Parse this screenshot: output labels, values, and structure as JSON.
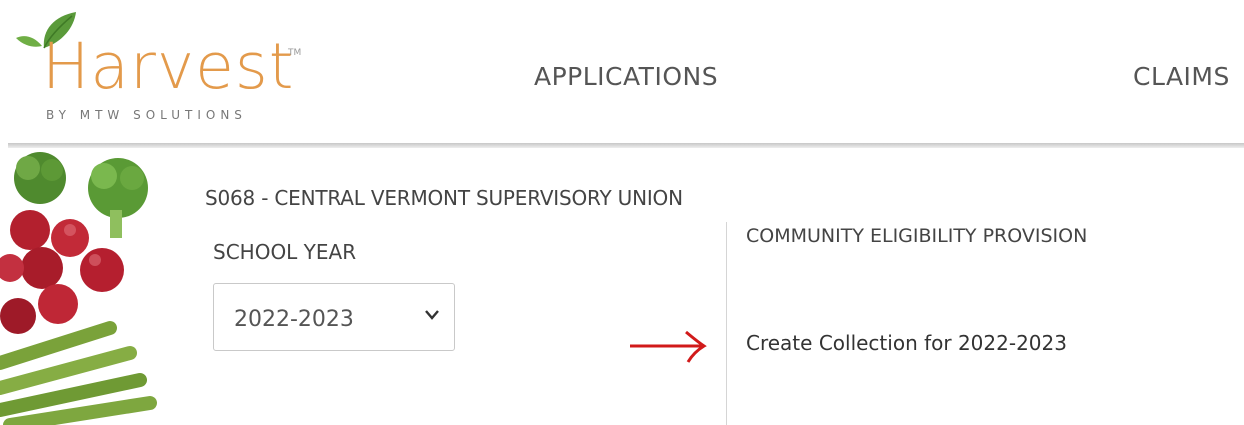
{
  "header": {
    "logo_text": "Harvest",
    "logo_tm": "TM",
    "logo_tagline": "BY MTW SOLUTIONS",
    "nav": {
      "applications": "APPLICATIONS",
      "claims": "CLAIMS"
    }
  },
  "main": {
    "district": "S068 - CENTRAL VERMONT SUPERVISORY UNION",
    "school_year_label": "SCHOOL YEAR",
    "school_year_value": "2022-2023",
    "cep_title": "COMMUNITY ELIGIBILITY PROVISION",
    "create_collection_link": "Create Collection for 2022-2023"
  },
  "colors": {
    "brand_orange": "#e39a4b",
    "leaf_green": "#5a9a3a",
    "annotation_arrow": "#d11a1a"
  },
  "icons": [
    "leaf-logo-icon",
    "chevron-down-icon",
    "red-arrow-annotation"
  ]
}
